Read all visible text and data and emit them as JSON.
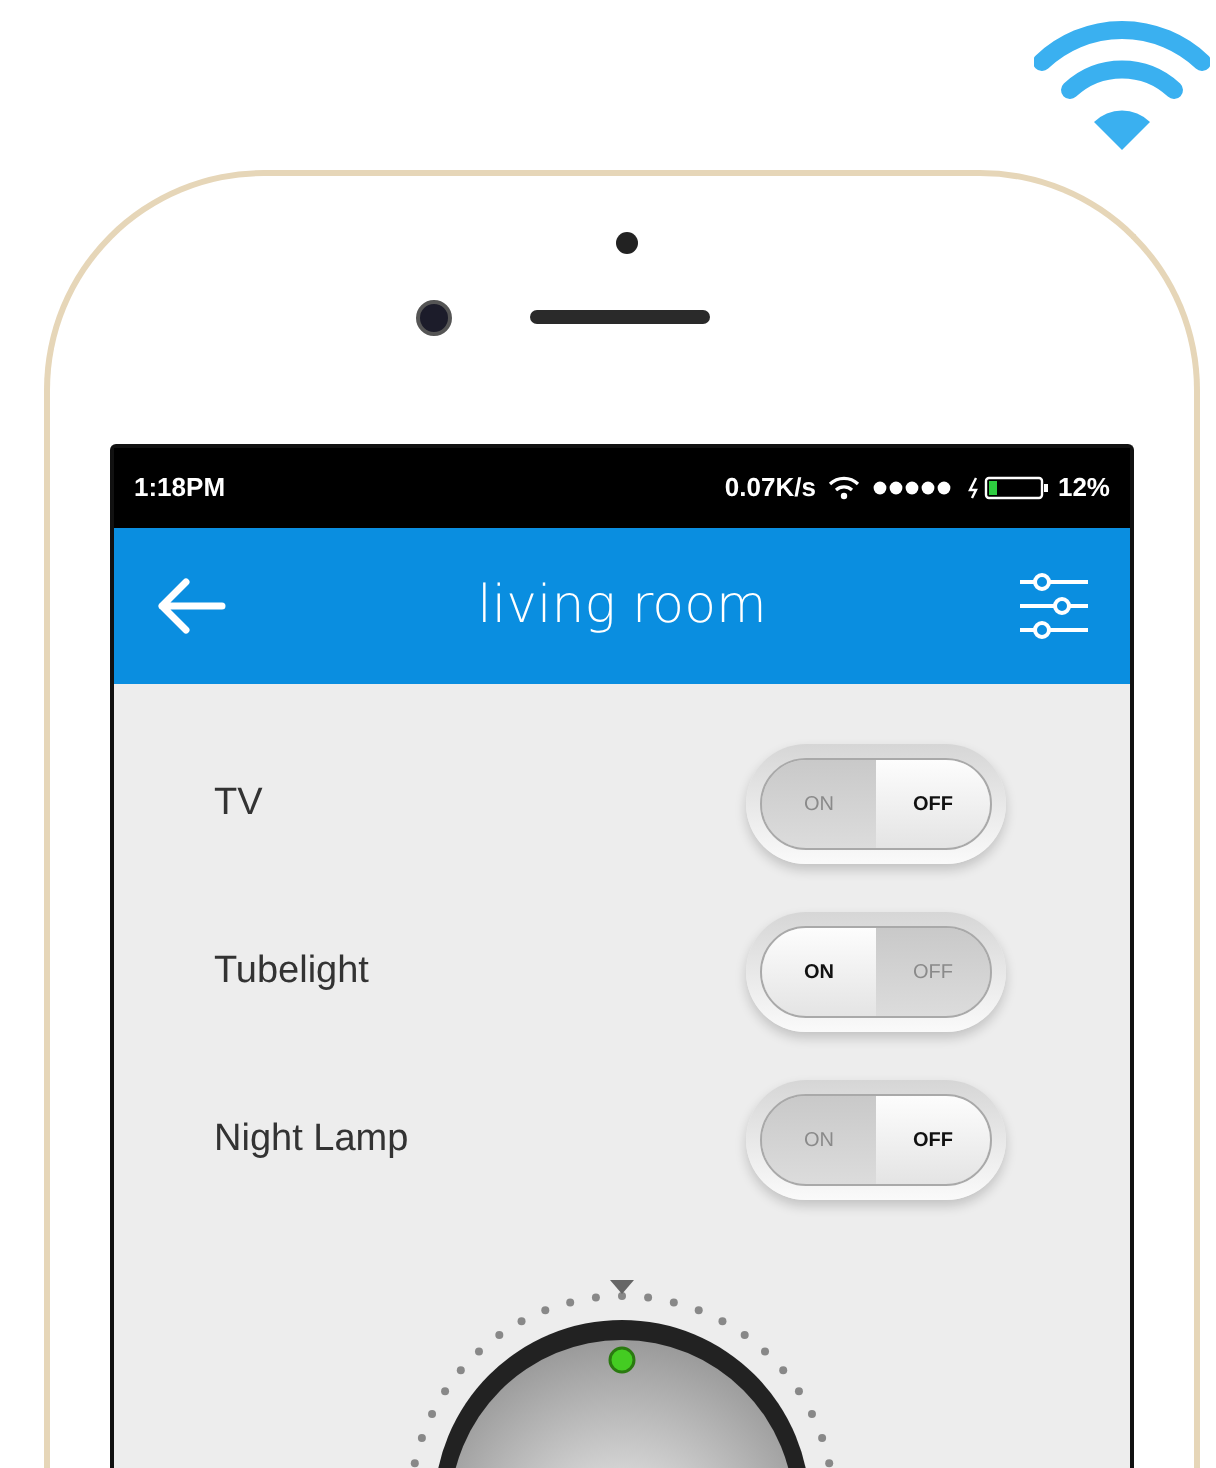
{
  "status_bar": {
    "time": "1:18PM",
    "speed": "0.07K/s",
    "battery": "12%"
  },
  "header": {
    "title": "living room"
  },
  "devices": [
    {
      "name": "TV",
      "on_label": "ON",
      "off_label": "OFF",
      "on": false
    },
    {
      "name": "Tubelight",
      "on_label": "ON",
      "off_label": "OFF",
      "on": true
    },
    {
      "name": "Night Lamp",
      "on_label": "ON",
      "off_label": "OFF",
      "on": false
    }
  ]
}
